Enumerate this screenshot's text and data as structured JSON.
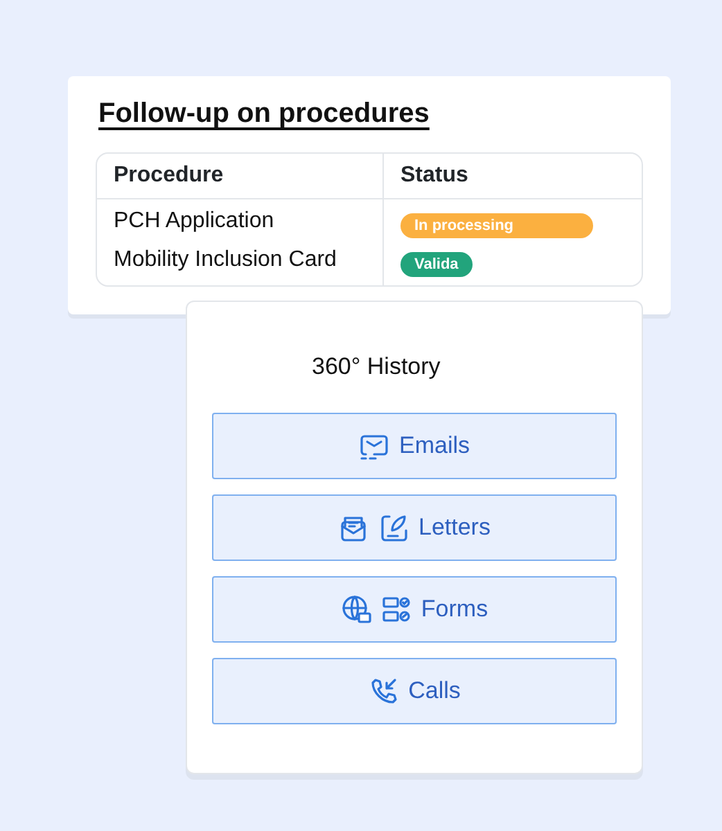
{
  "procedures_card": {
    "title": "Follow-up on procedures",
    "columns": [
      "Procedure",
      "Status"
    ],
    "rows": [
      {
        "procedure": "PCH Application",
        "status": "In processing",
        "color": "#fbb040"
      },
      {
        "procedure": "Mobility Inclusion Card",
        "status": "Valida",
        "color": "#22a47c"
      }
    ]
  },
  "history_card": {
    "title": "360° History",
    "buttons": [
      {
        "label": "Emails"
      },
      {
        "label": "Letters"
      },
      {
        "label": "Forms"
      },
      {
        "label": "Calls"
      }
    ]
  }
}
